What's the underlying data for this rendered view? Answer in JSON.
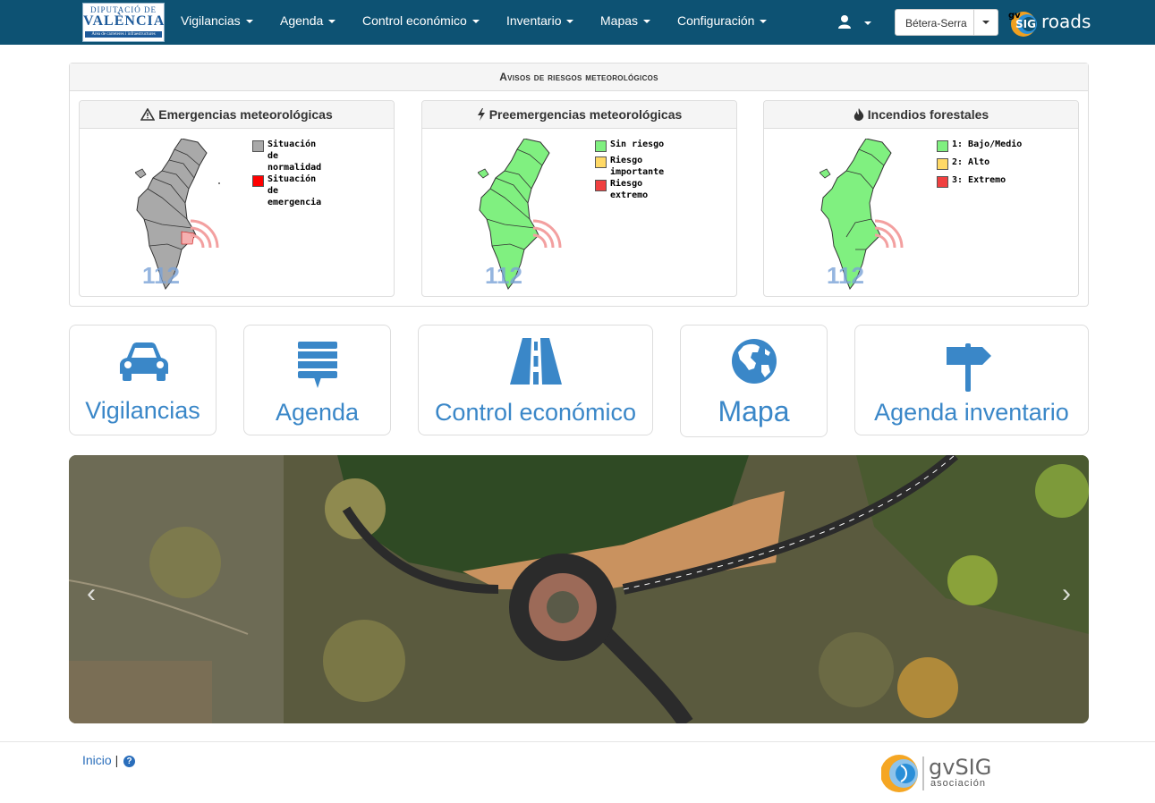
{
  "nav": {
    "logo": {
      "line1": "DIPUTACIÓ DE",
      "line2": "VALÈNCIA",
      "line3": "Àrea de carreteres i infraestructures"
    },
    "items": [
      {
        "label": "Vigilancias"
      },
      {
        "label": "Agenda"
      },
      {
        "label": "Control económico"
      },
      {
        "label": "Inventario"
      },
      {
        "label": "Mapas"
      },
      {
        "label": "Configuración"
      }
    ],
    "user_icon": "user-icon",
    "selector_value": "Bétera-Serra",
    "brand": {
      "gv": "gv",
      "sig": "SIG",
      "roads": "roads"
    }
  },
  "alerts": {
    "title": "Avisos de riesgos meteorológicos",
    "panels": [
      {
        "title": "Emergencias meteorológicas",
        "icon": "warning-icon",
        "legend": [
          {
            "label": "Situación de normalidad",
            "color": "#a9a9a9"
          },
          {
            "label": "Situación de emergencia",
            "color": "#ff0000"
          }
        ]
      },
      {
        "title": "Preemergencias meteorológicas",
        "icon": "bolt-icon",
        "legend": [
          {
            "label": "Sin riesgo",
            "color": "#80f080"
          },
          {
            "label": "Riesgo importante",
            "color": "#ffd966"
          },
          {
            "label": "Riesgo extremo",
            "color": "#f04040"
          }
        ]
      },
      {
        "title": "Incendios forestales",
        "icon": "fire-icon",
        "legend": [
          {
            "label": "1: Bajo/Medio",
            "color": "#80f080"
          },
          {
            "label": "2: Alto",
            "color": "#ffd966"
          },
          {
            "label": "3: Extremo",
            "color": "#f04040"
          }
        ]
      }
    ],
    "badge": "112"
  },
  "tiles": [
    {
      "label": "Vigilancias",
      "icon": "car-icon"
    },
    {
      "label": "Agenda",
      "icon": "chat-list-icon"
    },
    {
      "label": "Control económico",
      "icon": "road-icon"
    },
    {
      "label": "Mapa",
      "icon": "globe-icon"
    },
    {
      "label": "Agenda inventario",
      "icon": "signpost-icon"
    }
  ],
  "carousel": {
    "prev": "‹",
    "next": "›"
  },
  "footer": {
    "home": "Inicio",
    "sep": "|",
    "help": "?",
    "org": "gvSIG",
    "org_sub": "asociación"
  },
  "colors": {
    "navbar": "#0d5273",
    "accent": "#3a87c8"
  }
}
